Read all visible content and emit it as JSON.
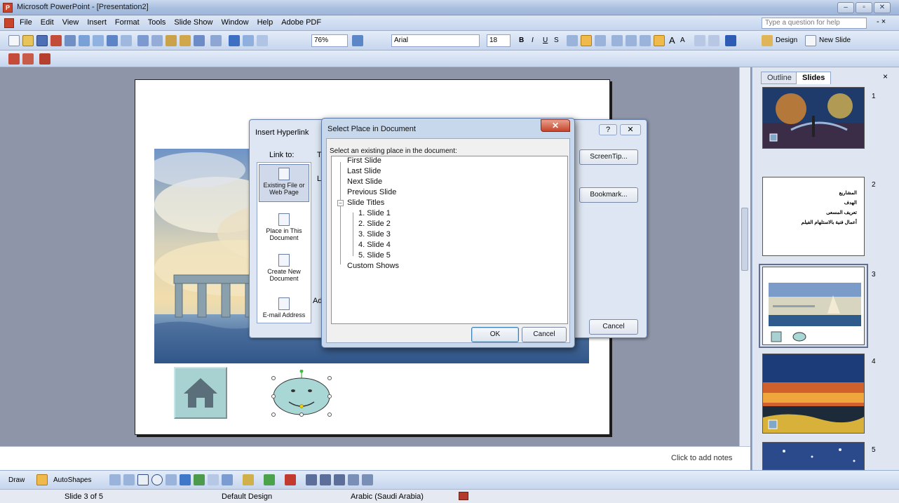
{
  "window": {
    "title": "Microsoft PowerPoint - [Presentation2]",
    "minimize": "–",
    "restore": "▫",
    "close": "✕"
  },
  "menu": {
    "items": [
      "File",
      "Edit",
      "View",
      "Insert",
      "Format",
      "Tools",
      "Slide Show",
      "Window",
      "Help",
      "Adobe PDF"
    ],
    "help_placeholder": "Type a question for help",
    "close_doc": "- ×"
  },
  "toolbar": {
    "zoom": "76%",
    "font": "Arial",
    "font_size": "18",
    "design_label": "Design",
    "new_slide_label": "New Slide",
    "bold": "B",
    "italic": "I",
    "underline": "U",
    "shadow": "S",
    "grow_font": "A",
    "shrink_font": "A"
  },
  "notes": {
    "placeholder": "Click to add notes"
  },
  "pane": {
    "tabs": [
      "Outline",
      "Slides"
    ],
    "close": "×",
    "thumb_numbers": [
      "1",
      "2",
      "3",
      "4",
      "5"
    ],
    "slide2_lines": [
      "المشاريع",
      "الهدف",
      "تعريف المسعى",
      "أعمال فنية بالاستلهام الفيلم"
    ]
  },
  "draw_toolbar": {
    "draw_label": "Draw",
    "autoshapes_label": "AutoShapes"
  },
  "status": {
    "slide_counter": "Slide 3 of 5",
    "design": "Default Design",
    "language": "Arabic (Saudi Arabia)"
  },
  "hyperlink_dialog": {
    "title": "Insert Hyperlink",
    "link_to_label": "Link to:",
    "text_label_fragment": "Te",
    "look_label_fragment": "Lo",
    "address_label_fragment": "Ad",
    "link_options": [
      "Existing File or Web Page",
      "Place in This Document",
      "Create New Document",
      "E-mail Address"
    ],
    "screentip_label": "ScreenTip...",
    "bookmark_label": "Bookmark...",
    "cancel_label": "Cancel",
    "help": "?",
    "close": "✕"
  },
  "select_place_dialog": {
    "title": "Select Place in Document",
    "prompt": "Select an existing place in the document:",
    "items": [
      {
        "label": "First Slide",
        "level": 0
      },
      {
        "label": "Last Slide",
        "level": 0
      },
      {
        "label": "Next Slide",
        "level": 0
      },
      {
        "label": "Previous Slide",
        "level": 0
      },
      {
        "label": "Slide Titles",
        "level": 0,
        "expander": "−"
      },
      {
        "label": "1. Slide 1",
        "level": 1
      },
      {
        "label": "2. Slide 2",
        "level": 1
      },
      {
        "label": "3. Slide 3",
        "level": 1
      },
      {
        "label": "4. Slide 4",
        "level": 1
      },
      {
        "label": "5. Slide 5",
        "level": 1
      },
      {
        "label": "Custom Shows",
        "level": 0
      }
    ],
    "ok_label": "OK",
    "cancel_label": "Cancel",
    "close": "✕"
  },
  "colors": {
    "titlebar": "#a9bfe0",
    "workspace": "#8e95a8",
    "dialog_frame": "#c7d7ec",
    "close_red": "#c7442b"
  }
}
